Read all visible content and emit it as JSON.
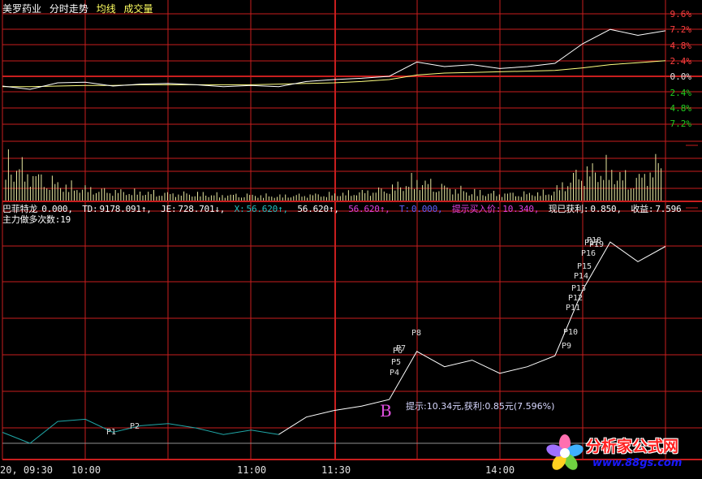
{
  "header": {
    "stock_name": "美罗药业",
    "chart_mode": "分时走势",
    "avg_line_label": "均线",
    "volume_label": "成交量"
  },
  "colors": {
    "grid": "#c81e1e",
    "price_line": "#ffffff",
    "avg_line": "#ffff80",
    "volume_bar": "#e8e8a0",
    "up_text": "#ff4040",
    "down_text": "#20d020",
    "indicator_low": "#20a8a8",
    "indicator_high": "#ffffff",
    "tip_color": "#d070ff"
  },
  "price_axis": {
    "labels_up": [
      "9.6%",
      "7.2%",
      "4.8%",
      "2.4%"
    ],
    "zero": "0.0%",
    "labels_down": [
      "2.4%",
      "4.8%",
      "7.2%"
    ]
  },
  "time_axis": {
    "labels": [
      "20, 09:30",
      "10:00",
      "11:00",
      "11:30",
      "14:00"
    ]
  },
  "indicator": {
    "name": "巴菲特龙",
    "name_value": "0.000,",
    "td_label": "TD:",
    "td_value": "9178.091↑,",
    "je_label": "JE:",
    "je_value": "728.701↓,",
    "x_label": "X:",
    "x_value": "56.620↑,",
    "x2_value": "56.620↑,",
    "x3_value": "56.620↑,",
    "t_label": "T:",
    "t_value": "0.000,",
    "hint_label": "提示买入价:",
    "hint_value": "10.340,",
    "profit_label": "现已获利:",
    "profit_value": "0.850,",
    "gain_label": "收益:",
    "gain_value": "7.596",
    "main_force_label": "主力做多次数:",
    "main_force_value": "19"
  },
  "signals": {
    "buy_marker": "B",
    "tip_text": "提示:10.34元,获利:0.85元(7.596%)",
    "points": [
      "P1",
      "P2",
      "P4",
      "P5",
      "P6",
      "P7",
      "P8",
      "P9",
      "P10",
      "P11",
      "P12",
      "P13",
      "P14",
      "P15",
      "P16",
      "P17",
      "P18",
      "P19"
    ]
  },
  "watermark": {
    "site_name": "分析家公式网",
    "url": "www.88gs.com"
  },
  "chart_data": [
    {
      "type": "line",
      "title": "分时走势",
      "ylabel": "%",
      "ylim": [
        -9.6,
        9.6
      ],
      "x": [
        0,
        10,
        20,
        30,
        40,
        50,
        60,
        70,
        80,
        90,
        100,
        110,
        120,
        130,
        140,
        150,
        160,
        170,
        180,
        190,
        200,
        210,
        220,
        230,
        240
      ],
      "series": [
        {
          "name": "price",
          "values": [
            -1.5,
            -2.0,
            -1.0,
            -0.9,
            -1.5,
            -1.2,
            -1.1,
            -1.3,
            -1.6,
            -1.4,
            -1.6,
            -0.8,
            -0.5,
            -0.3,
            0.0,
            2.2,
            1.5,
            1.8,
            1.2,
            1.5,
            2.0,
            5.0,
            7.2,
            6.3,
            7.0
          ]
        },
        {
          "name": "均线",
          "values": [
            -1.6,
            -1.6,
            -1.5,
            -1.4,
            -1.4,
            -1.3,
            -1.3,
            -1.3,
            -1.3,
            -1.3,
            -1.2,
            -1.1,
            -1.0,
            -0.8,
            -0.5,
            0.2,
            0.5,
            0.6,
            0.7,
            0.8,
            0.9,
            1.3,
            1.8,
            2.1,
            2.4
          ]
        }
      ]
    },
    {
      "type": "bar",
      "title": "成交量",
      "x": [
        0,
        10,
        20,
        30,
        40,
        50,
        60,
        70,
        80,
        90,
        100,
        110,
        120,
        130,
        140,
        150,
        160,
        170,
        180,
        190,
        200,
        210,
        220,
        230,
        240
      ],
      "values": [
        90,
        55,
        35,
        25,
        20,
        18,
        15,
        15,
        12,
        12,
        10,
        12,
        14,
        18,
        25,
        45,
        30,
        20,
        15,
        15,
        18,
        60,
        70,
        40,
        85
      ]
    }
  ]
}
